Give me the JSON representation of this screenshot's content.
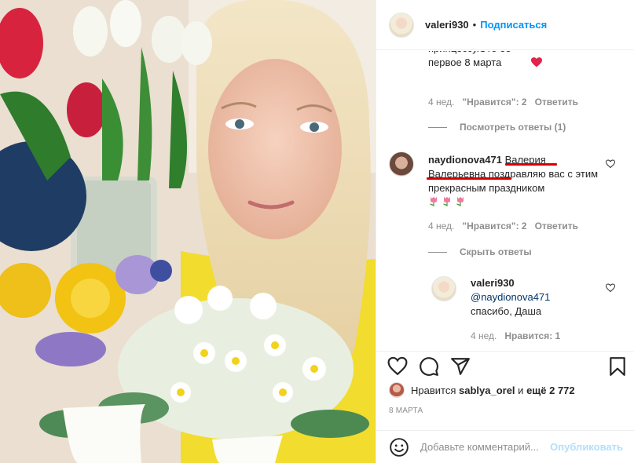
{
  "post": {
    "author": "valeri930",
    "follow_label": "Подписаться",
    "separator": "•"
  },
  "comments": [
    {
      "text_tail": "принцессу.Это ее первое 8 марта",
      "emoji": "heart",
      "time": "4 нед.",
      "likes": "\"Нравится\": 2",
      "reply": "Ответить",
      "toggle": "Посмотреть ответы (1)"
    },
    {
      "user": "naydionova471",
      "text": "Валерия Валерьевна поздравляю вас с этим прекрасным праздником",
      "emoji": "tulips",
      "time": "4 нед.",
      "likes": "\"Нравится\": 2",
      "reply": "Ответить",
      "toggle": "Скрыть ответы",
      "reply_item": {
        "user": "valeri930",
        "mention": "@naydionova471",
        "text": "спасибо, Даша",
        "time": "4 нед.",
        "likes": "Нравится: 1"
      }
    }
  ],
  "likes_summary": {
    "prefix": "Нравится",
    "user": "sablya_orel",
    "and": "и",
    "rest": "ещё 2 772"
  },
  "date": "8 МАРТА",
  "composer": {
    "placeholder": "Добавьте комментарий...",
    "post_label": "Опубликовать"
  },
  "colors": {
    "accent": "#0095f6",
    "underline": "#d60000",
    "muted": "#8e8e8e"
  },
  "icons": [
    "heart-icon",
    "comment-icon",
    "share-icon",
    "bookmark-icon",
    "emoji-icon"
  ]
}
